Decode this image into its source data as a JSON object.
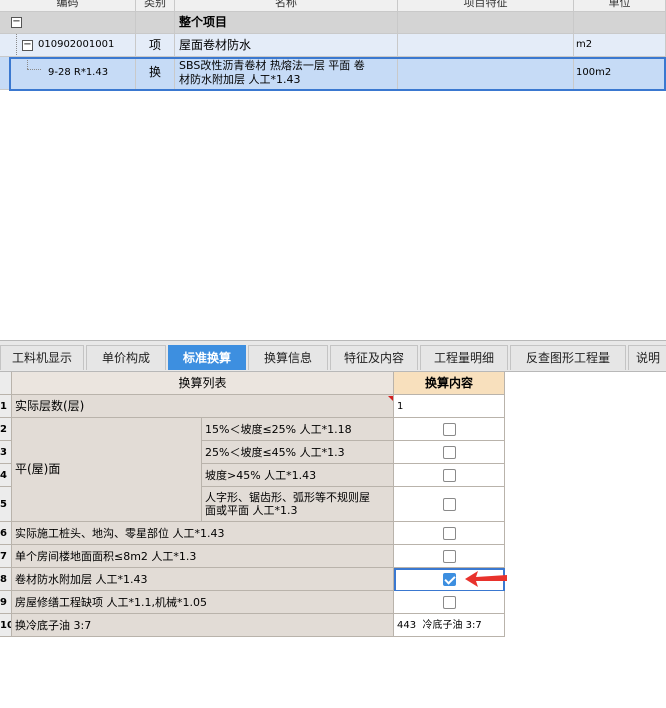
{
  "top_grid": {
    "headers": [
      "编码",
      "类别",
      "名称",
      "项目特征",
      "单位"
    ],
    "rows": [
      {
        "code": "",
        "type": "",
        "name": "整个项目",
        "feature": "",
        "unit": ""
      },
      {
        "code": "010902001001",
        "type": "项",
        "name": "屋面卷材防水",
        "feature": "",
        "unit": "m2"
      },
      {
        "code": "9-28 R*1.43",
        "type": "换",
        "name_line1": "SBS改性沥青卷材 热熔法一层 平面  卷",
        "name_line2": "材防水附加层 人工*1.43",
        "feature": "",
        "unit": "100m2"
      }
    ]
  },
  "tabs": [
    {
      "label": "工料机显示",
      "active": false
    },
    {
      "label": "单价构成",
      "active": false
    },
    {
      "label": "标准换算",
      "active": true
    },
    {
      "label": "换算信息",
      "active": false
    },
    {
      "label": "特征及内容",
      "active": false
    },
    {
      "label": "工程量明细",
      "active": false
    },
    {
      "label": "反查图形工程量",
      "active": false
    },
    {
      "label": "说明",
      "active": false
    }
  ],
  "lower_grid": {
    "header_list": "换算列表",
    "header_content": "换算内容",
    "row_numbers": [
      "1",
      "2",
      "3",
      "4",
      "5",
      "6",
      "7",
      "8",
      "9",
      "10"
    ],
    "group_label": "平(屋)面",
    "rows": [
      {
        "num": "1",
        "label": "实际层数(层)",
        "value": "1"
      },
      {
        "num": "2",
        "label": "15%＜坡度≤25% 人工*1.18",
        "checked": false
      },
      {
        "num": "3",
        "label": "25%＜坡度≤45% 人工*1.3",
        "checked": false
      },
      {
        "num": "4",
        "label": "坡度>45% 人工*1.43",
        "checked": false
      },
      {
        "num": "5",
        "label_line1": "人字形、锯齿形、弧形等不规则屋",
        "label_line2": "面或平面 人工*1.3",
        "checked": false
      },
      {
        "num": "6",
        "label": "实际施工桩头、地沟、零星部位 人工*1.43",
        "checked": false
      },
      {
        "num": "7",
        "label": "单个房间楼地面面积≤8m2 人工*1.3",
        "checked": false
      },
      {
        "num": "8",
        "label": "卷材防水附加层 人工*1.43",
        "checked": true
      },
      {
        "num": "9",
        "label": "房屋修缮工程缺项 人工*1.1,机械*1.05",
        "checked": false
      },
      {
        "num": "10",
        "label": "换冷底子油 3:7",
        "value": "443  冷底子油 3:7"
      }
    ]
  },
  "colors": {
    "tab_active": "#3d8fe0",
    "selection_border": "#3a78d0",
    "arrow": "#e8322c"
  },
  "icons": {
    "expander": "minus-box-icon",
    "arrow": "red-arrow-icon",
    "check": "checkmark-icon"
  }
}
